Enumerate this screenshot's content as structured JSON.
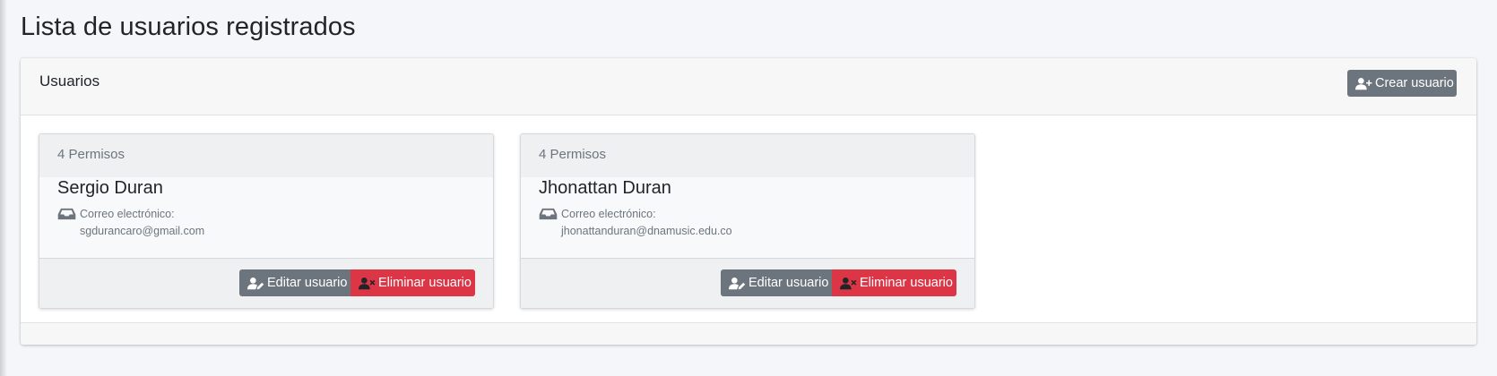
{
  "page": {
    "title": "Lista de usuarios registrados"
  },
  "panel": {
    "title": "Usuarios",
    "create_label": "Crear usuario"
  },
  "users": [
    {
      "permissions": "4 Permisos",
      "name": "Sergio Duran",
      "email_label": "Correo electrónico:",
      "email": "sgdurancaro@gmail.com",
      "edit_label": "Editar usuario",
      "delete_label": "Eliminar usuario"
    },
    {
      "permissions": "4 Permisos",
      "name": "Jhonattan Duran",
      "email_label": "Correo electrónico:",
      "email": "jhonattanduran@dnamusic.edu.co",
      "edit_label": "Editar usuario",
      "delete_label": "Eliminar usuario"
    }
  ],
  "icons": {
    "create": "user-plus-icon",
    "email": "inbox-icon",
    "edit": "user-edit-icon",
    "delete": "user-times-icon"
  },
  "colors": {
    "secondary": "#6c757d",
    "danger": "#dc3545",
    "background": "#f4f6f9"
  }
}
